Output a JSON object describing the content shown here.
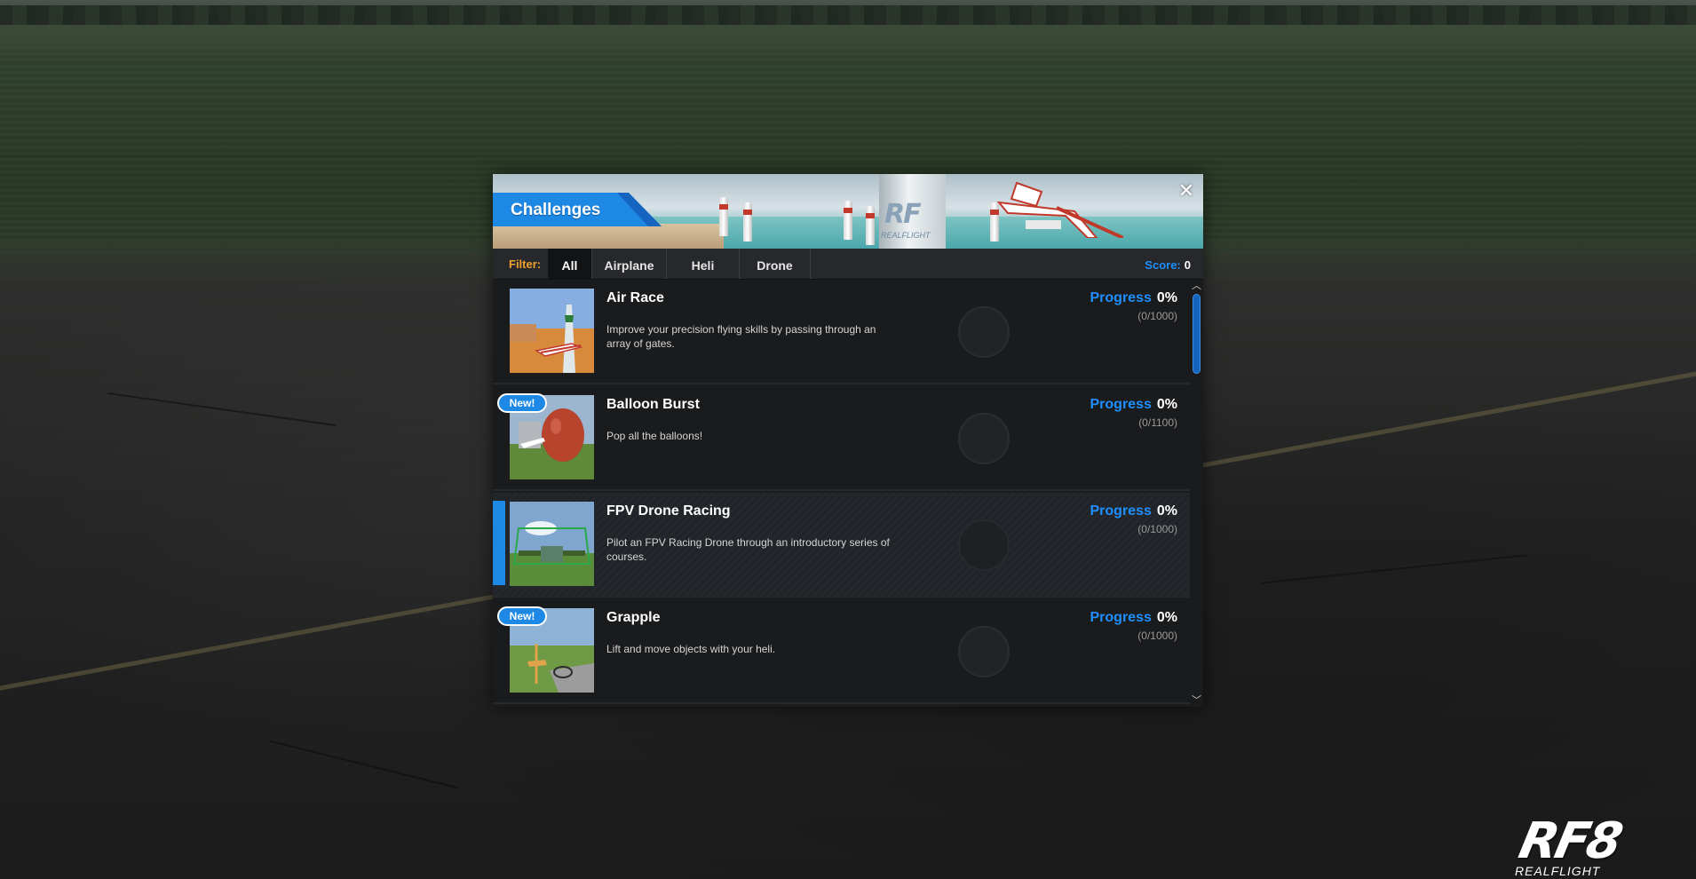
{
  "dialog": {
    "title": "Challenges",
    "close_glyph": "✕"
  },
  "filter": {
    "label": "Filter:",
    "tabs": [
      {
        "label": "All",
        "active": true
      },
      {
        "label": "Airplane",
        "active": false
      },
      {
        "label": "Heli",
        "active": false
      },
      {
        "label": "Drone",
        "active": false
      }
    ],
    "score_label": "Score:",
    "score_value": "0"
  },
  "challenges": [
    {
      "title": "Air Race",
      "description": "Improve your precision flying skills by passing through an array of gates.",
      "progress_label": "Progress",
      "progress_value": "0%",
      "progress_count": "(0/1000)",
      "is_new": false,
      "selected": false
    },
    {
      "title": "Balloon Burst",
      "description": "Pop all the balloons!",
      "progress_label": "Progress",
      "progress_value": "0%",
      "progress_count": "(0/1100)",
      "is_new": true,
      "badge": "New!",
      "selected": false
    },
    {
      "title": "FPV Drone Racing",
      "description": "Pilot an FPV Racing Drone through an introductory series of courses.",
      "progress_label": "Progress",
      "progress_value": "0%",
      "progress_count": "(0/1000)",
      "is_new": false,
      "selected": true
    },
    {
      "title": "Grapple",
      "description": "Lift and move objects with your heli.",
      "progress_label": "Progress",
      "progress_value": "0%",
      "progress_count": "(0/1000)",
      "is_new": true,
      "badge": "New!",
      "selected": false
    }
  ],
  "scrollbar": {
    "up_glyph": "︿",
    "down_glyph": "﹀"
  },
  "logo": {
    "mark": "RF8",
    "name": "REALFLIGHT"
  },
  "colors": {
    "accent_blue": "#1e88e5",
    "filter_orange": "#f0a030",
    "panel_dark": "#1a1b1d"
  }
}
